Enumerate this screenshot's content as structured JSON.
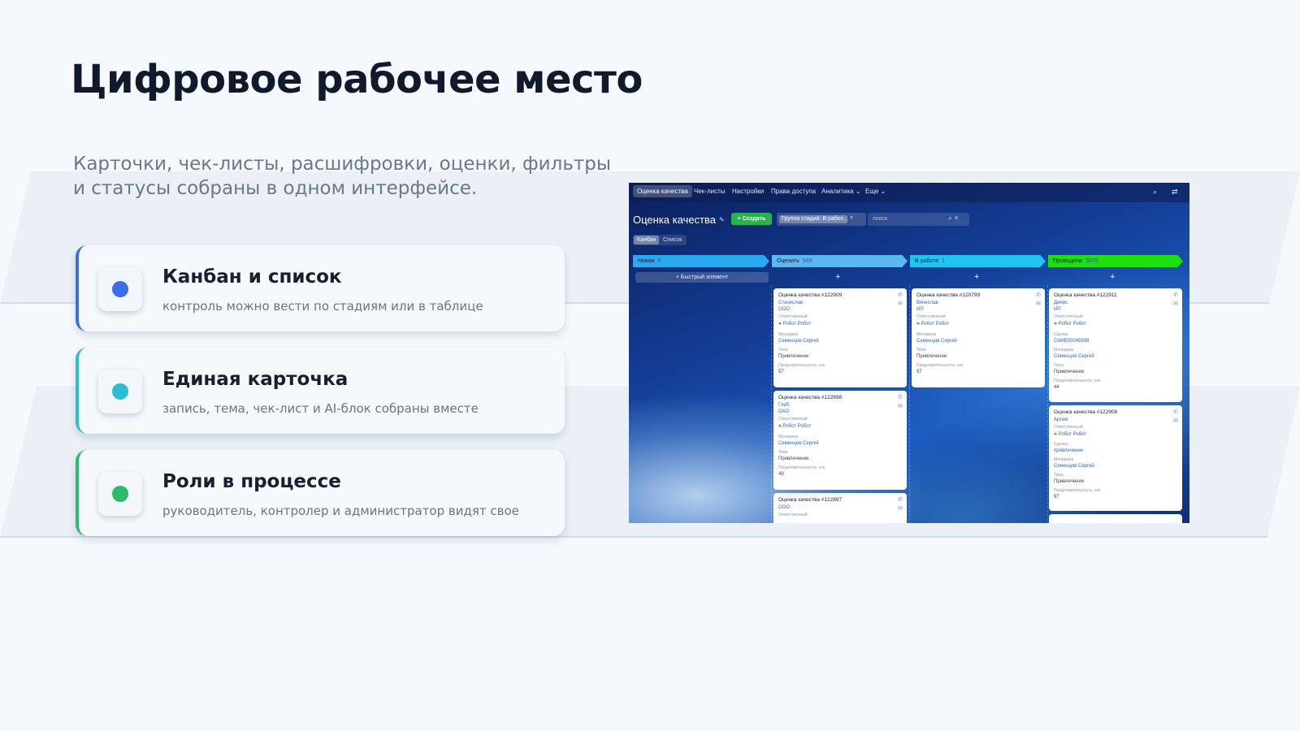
{
  "heading": "Цифровое рабочее место",
  "subheading": "Карточки, чек-листы, расшифровки, оценки, фильтры и статусы собраны в одном интерфейсе.",
  "features": [
    {
      "title": "Канбан и список",
      "description": "контроль можно вести по стадиям или в таблице",
      "color": "#3a6ee8"
    },
    {
      "title": "Единая карточка",
      "description": "запись, тема, чек-лист и AI-блок собраны вместе",
      "color": "#2bbdd2"
    },
    {
      "title": "Роли в процессе",
      "description": "руководитель, контролер и администратор видят свое",
      "color": "#2dbb6a"
    }
  ],
  "screenshot": {
    "nav": [
      "Оценка качества",
      "Чек-листы",
      "Настройки",
      "Права доступа",
      "Аналитика ⌄",
      "Еще ⌄"
    ],
    "title": "Оценка качества",
    "create_label": "+ Создать",
    "filter_chip": "Группа стадий: В работ...",
    "search_placeholder": "поиск",
    "views": [
      "Канбан",
      "Список"
    ],
    "quick_add": "+ Быстрый элемент",
    "stages": [
      {
        "name": "Новая",
        "count": "0",
        "color": "#29a9ee"
      },
      {
        "name": "Оценить",
        "count": "549",
        "color": "#5cb7f0"
      },
      {
        "name": "В работе",
        "count": "1",
        "color": "#1fc4ef"
      },
      {
        "name": "Проведена",
        "count": "5070",
        "color": "#1ee00c"
      }
    ],
    "labels": {
      "responsible": "Ответственный",
      "manager": "Менеджер",
      "topic": "Тема",
      "duration": "Продолжительность, сек",
      "deal": "Сделка"
    },
    "cards": [
      {
        "title": "Оценка качества #122909",
        "contact": "Станислав",
        "company": "ООО",
        "responsible": "Робот Робот",
        "manager": "Семенцов Сергей",
        "topic": "Привлечение",
        "duration": "57"
      },
      {
        "title": "Оценка качества #122898",
        "contact": "Глеб",
        "company": "ОАО",
        "responsible": "Робот Робот",
        "manager": "Семенцов Сергей",
        "topic": "Привлечение",
        "duration": "49"
      },
      {
        "title": "Оценка качества #122897",
        "company": "ООО"
      },
      {
        "title": "Оценка качества #120799",
        "contact": "Вячеслав",
        "company": "ИП",
        "responsible": "Робот Робот",
        "manager": "Семенцов Сергей",
        "topic": "Привлечение",
        "duration": "97"
      },
      {
        "title": "Оценка качества #122911",
        "contact": "Денис",
        "company": "ИП",
        "responsible": "Робот Робот",
        "deal": "СКМЕ00045598",
        "manager": "Семенцов Сергей",
        "topic": "Привлечение",
        "duration": "44"
      },
      {
        "title": "Оценка качества #122908",
        "contact": "Артем",
        "responsible": "Робот Робот",
        "deal": "привлечение",
        "manager": "Семенцов Сергей",
        "topic": "Привлечение",
        "duration": "97"
      }
    ]
  }
}
